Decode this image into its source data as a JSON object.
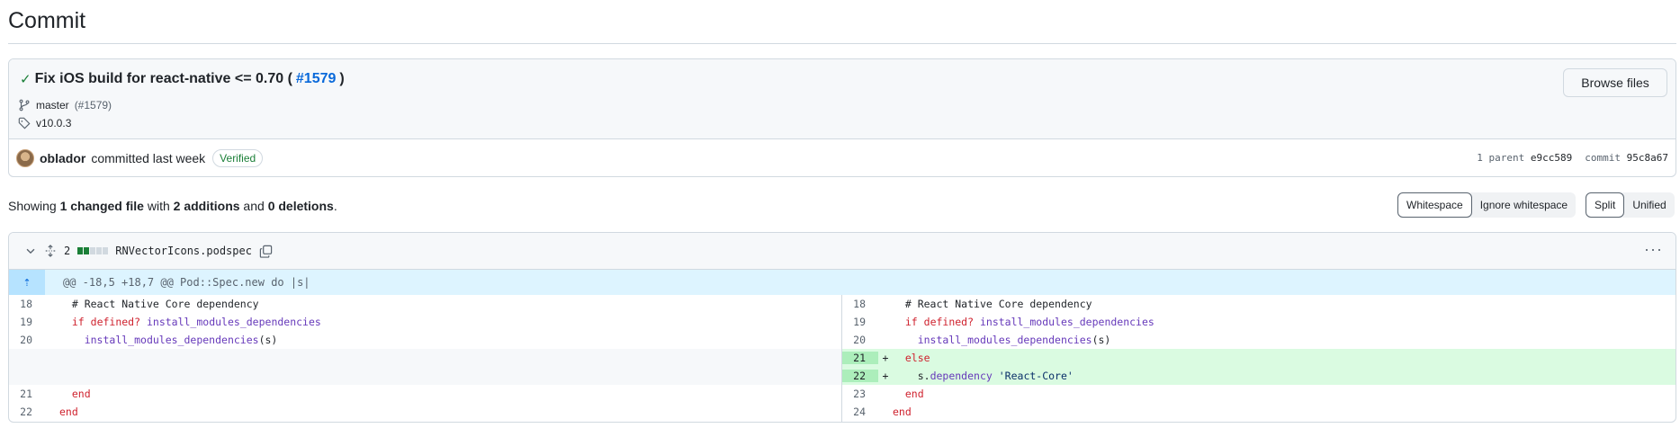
{
  "page": {
    "title": "Commit"
  },
  "commit": {
    "message": "Fix iOS build for react-native <= 0.70 (",
    "pr_link": "#1579",
    "message_end": ")",
    "branch": "master",
    "branch_pr": "(#1579)",
    "tag": "v10.0.3",
    "browse_label": "Browse files",
    "author": "oblador",
    "committed_text": "committed last week",
    "verified": "Verified",
    "parent_label": "1 parent",
    "parent_sha": "e9cc589",
    "commit_label": "commit",
    "commit_sha": "95c8a67"
  },
  "summary": {
    "prefix": "Showing ",
    "files": "1 changed file",
    "with": " with ",
    "additions": "2 additions",
    "and": " and ",
    "deletions": "0 deletions",
    "suffix": "."
  },
  "toggles": {
    "whitespace": "Whitespace",
    "ignore_whitespace": "Ignore whitespace",
    "split": "Split",
    "unified": "Unified"
  },
  "file": {
    "change_count": "2",
    "name": "RNVectorIcons.podspec",
    "hunk_header": "@@ -18,5 +18,7 @@ Pod::Spec.new do |s|"
  },
  "diff": {
    "left": [
      {
        "num": "18",
        "indent": "  ",
        "parts": [
          [
            "# React Native Core dependency",
            "cm"
          ]
        ]
      },
      {
        "num": "19",
        "indent": "  ",
        "parts": [
          [
            "if ",
            "kw"
          ],
          [
            "defined?",
            "kw"
          ],
          [
            " ",
            ""
          ],
          [
            "install_modules_dependencies",
            "fn"
          ]
        ]
      },
      {
        "num": "20",
        "indent": "    ",
        "parts": [
          [
            "install_modules_dependencies",
            "fn"
          ],
          [
            "(s)",
            ""
          ]
        ]
      },
      {
        "num": "",
        "indent": "",
        "parts": [],
        "empty": true
      },
      {
        "num": "",
        "indent": "",
        "parts": [],
        "empty": true
      },
      {
        "num": "21",
        "indent": "  ",
        "parts": [
          [
            "end",
            "kw"
          ]
        ]
      },
      {
        "num": "22",
        "indent": "",
        "parts": [
          [
            "end",
            "kw"
          ]
        ]
      }
    ],
    "right": [
      {
        "num": "18",
        "sign": "",
        "indent": "  ",
        "parts": [
          [
            "# React Native Core dependency",
            "cm"
          ]
        ]
      },
      {
        "num": "19",
        "sign": "",
        "indent": "  ",
        "parts": [
          [
            "if ",
            "kw"
          ],
          [
            "defined?",
            "kw"
          ],
          [
            " ",
            ""
          ],
          [
            "install_modules_dependencies",
            "fn"
          ]
        ]
      },
      {
        "num": "20",
        "sign": "",
        "indent": "    ",
        "parts": [
          [
            "install_modules_dependencies",
            "fn"
          ],
          [
            "(s)",
            ""
          ]
        ]
      },
      {
        "num": "21",
        "sign": "+",
        "indent": "  ",
        "parts": [
          [
            "else",
            "kw"
          ]
        ],
        "add": true
      },
      {
        "num": "22",
        "sign": "+",
        "indent": "    ",
        "parts": [
          [
            "s.",
            ""
          ],
          [
            "dependency",
            "fn"
          ],
          [
            " ",
            ""
          ],
          [
            "'React-Core'",
            "str"
          ]
        ],
        "add": true
      },
      {
        "num": "23",
        "sign": "",
        "indent": "  ",
        "parts": [
          [
            "end",
            "kw"
          ]
        ]
      },
      {
        "num": "24",
        "sign": "",
        "indent": "",
        "parts": [
          [
            "end",
            "kw"
          ]
        ]
      }
    ]
  },
  "colors": {
    "addition": "#1a7f37",
    "link": "#0969da",
    "add_bg": "#dafbe1"
  }
}
